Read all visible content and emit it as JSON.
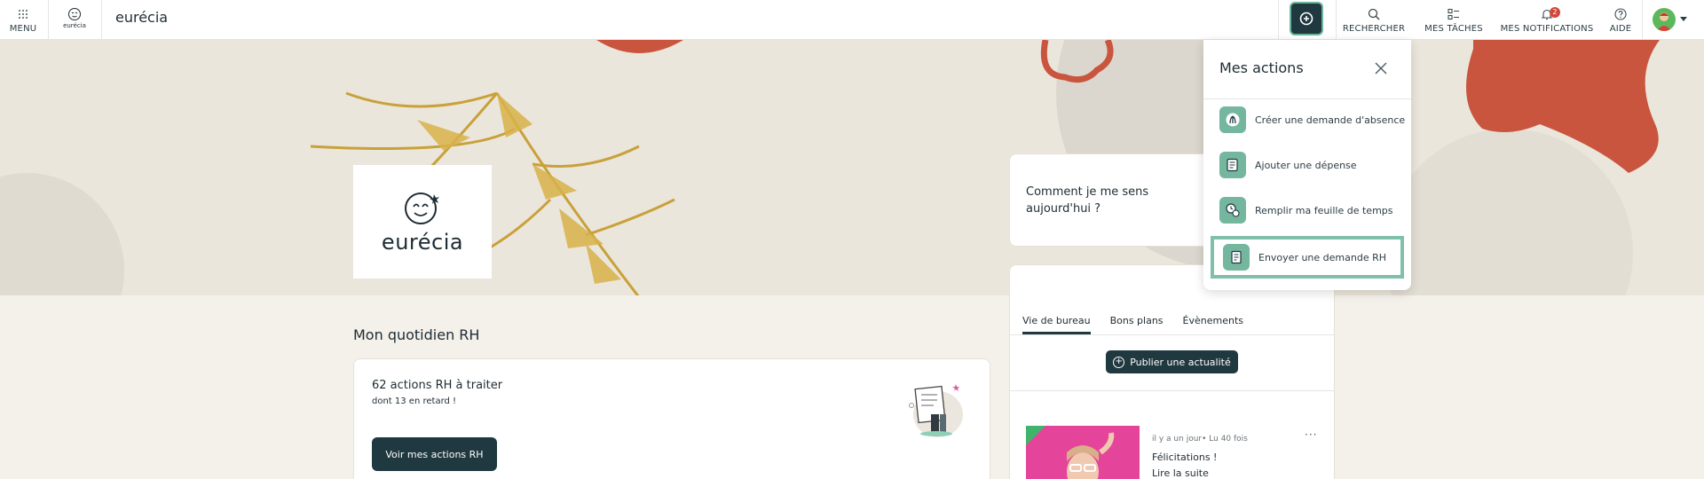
{
  "topbar": {
    "menu_label": "MENU",
    "small_logo_text": "eurécia",
    "brand": "eurécia",
    "search_label": "RECHERCHER",
    "tasks_label": "MES TÂCHES",
    "notifications_label": "MES NOTIFICATIONS",
    "notifications_count": "2",
    "help_label": "AIDE"
  },
  "hero": {
    "logo_text": "eurécia"
  },
  "main": {
    "section_title": "Mon quotidien RH",
    "hr_card": {
      "title": "62 actions RH à traiter",
      "subtitle": "dont 13 en retard !",
      "button": "Voir mes actions RH"
    }
  },
  "mood": {
    "question": "Comment je me sens aujourd'hui ?"
  },
  "feed": {
    "tabs": [
      {
        "label": "Vie de bureau",
        "active": true
      },
      {
        "label": "Bons plans",
        "active": false
      },
      {
        "label": "Évènements",
        "active": false
      }
    ],
    "publish_label": "Publier une actualité",
    "post": {
      "meta": "il y a un jour• Lu 40 fois",
      "title": "Félicitations !",
      "link": "Lire la suite",
      "more": "···"
    }
  },
  "actions_panel": {
    "title": "Mes actions",
    "items": [
      {
        "label": "Créer une demande d'absence",
        "icon": "palm-icon"
      },
      {
        "label": "Ajouter une dépense",
        "icon": "receipt-icon"
      },
      {
        "label": "Remplir ma feuille de temps",
        "icon": "timesheet-icon"
      },
      {
        "label": "Envoyer une demande RH",
        "icon": "document-icon",
        "highlighted": true
      }
    ]
  },
  "colors": {
    "primary": "#20383f",
    "accent": "#74b79e",
    "highlight": "#7fc1a8",
    "badge": "#d0493a",
    "decor_red": "#c9553f"
  }
}
